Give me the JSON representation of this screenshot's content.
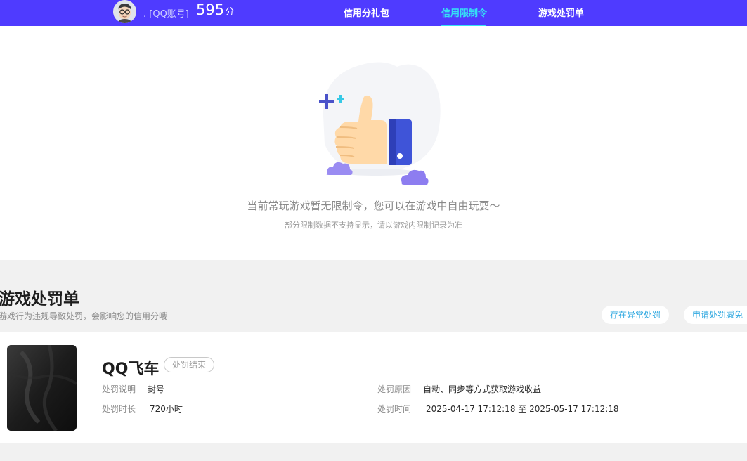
{
  "header": {
    "account_label": ". [QQ账号]",
    "score": "595",
    "score_unit": "分",
    "tabs": [
      {
        "label": "信用分礼包"
      },
      {
        "label": "信用限制令"
      },
      {
        "label": "游戏处罚单"
      }
    ],
    "active_tab": 1,
    "colors": {
      "bar": "#4f3bff",
      "active": "#35e0f5"
    }
  },
  "empty_state": {
    "illustration_icon": "thumbs-up-icon",
    "message": "当前常玩游戏暂无限制令，您可以在游戏中自由玩耍～",
    "note": "部分限制数据不支持显示，请以游戏内限制记录为准"
  },
  "penalties": {
    "title": "游戏处罚单",
    "description": "游戏行为违规导致处罚，会影响您的信用分哦",
    "actions": [
      {
        "label": "存在异常处罚"
      },
      {
        "label": "申请处罚减免"
      }
    ],
    "records": [
      {
        "game_name": "QQ飞车",
        "status": "处罚结束",
        "fields": {
          "desc_label": "处罚说明",
          "desc_value": "封号",
          "duration_label": "处罚时长",
          "duration_value": "720小时",
          "reason_label": "处罚原因",
          "reason_value": "自动、同步等方式获取游戏收益",
          "time_label": "处罚时间",
          "time_value": "2025-04-17 17:12:18 至 2025-05-17 17:12:18"
        }
      }
    ]
  }
}
